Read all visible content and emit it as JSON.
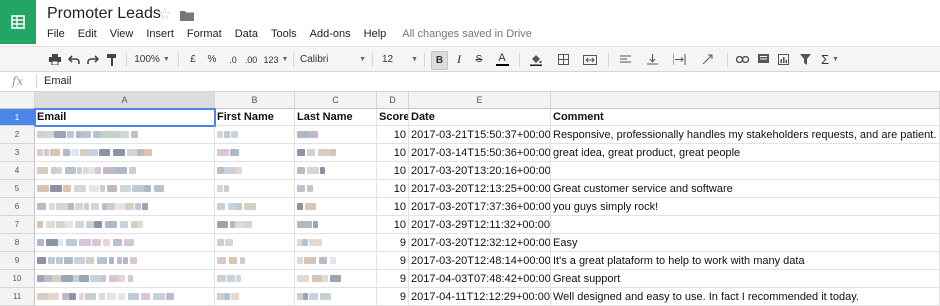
{
  "app": {
    "title": "Promoter Leads",
    "save_status": "All changes saved in Drive"
  },
  "menu": [
    "File",
    "Edit",
    "View",
    "Insert",
    "Format",
    "Data",
    "Tools",
    "Add-ons",
    "Help"
  ],
  "toolbar": {
    "zoom": "100%",
    "currency": "£",
    "percent": "%",
    "dec_decrease": ".0",
    "dec_increase": ".00",
    "more_formats": "123",
    "font": "Calibri",
    "font_size": "12",
    "bold": "B",
    "italic": "I",
    "strike": "S",
    "text_color": "A",
    "sum": "Σ"
  },
  "formula_bar": {
    "fx": "fx",
    "value": "Email"
  },
  "columns": [
    "A",
    "B",
    "C",
    "D",
    "E",
    ""
  ],
  "header_row": {
    "num": "1",
    "cells": [
      "Email",
      "First Name",
      "Last Name",
      "Score",
      "Date",
      "Comment"
    ]
  },
  "rows": [
    {
      "num": "2",
      "score": "10",
      "date": "2017-03-21T15:50:37+00:00",
      "comment": "Responsive, professionally handles my stakeholders requests, and are patient."
    },
    {
      "num": "3",
      "score": "10",
      "date": "2017-03-14T15:50:36+00:00",
      "comment": "great idea, great product, great people"
    },
    {
      "num": "4",
      "score": "10",
      "date": "2017-03-20T13:20:16+00:00",
      "comment": ""
    },
    {
      "num": "5",
      "score": "10",
      "date": "2017-03-20T12:13:25+00:00",
      "comment": "Great customer service and software"
    },
    {
      "num": "6",
      "score": "10",
      "date": "2017-03-20T17:37:36+00:00",
      "comment": "you guys simply rock!"
    },
    {
      "num": "7",
      "score": "10",
      "date": "2017-03-29T12:11:32+00:00",
      "comment": ""
    },
    {
      "num": "8",
      "score": "9",
      "date": "2017-03-20T12:32:12+00:00",
      "comment": "Easy"
    },
    {
      "num": "9",
      "score": "9",
      "date": "2017-03-20T12:48:14+00:00",
      "comment": "It's a great plataform to help to work with many data"
    },
    {
      "num": "10",
      "score": "9",
      "date": "2017-04-03T07:48:42+00:00",
      "comment": "Great support"
    },
    {
      "num": "11",
      "score": "9",
      "date": "2017-04-11T12:12:29+00:00",
      "comment": "Well designed and easy to use. In fact I recommended it today."
    }
  ],
  "colors": {
    "brand": "#23a566",
    "selection": "#4a86e8"
  }
}
